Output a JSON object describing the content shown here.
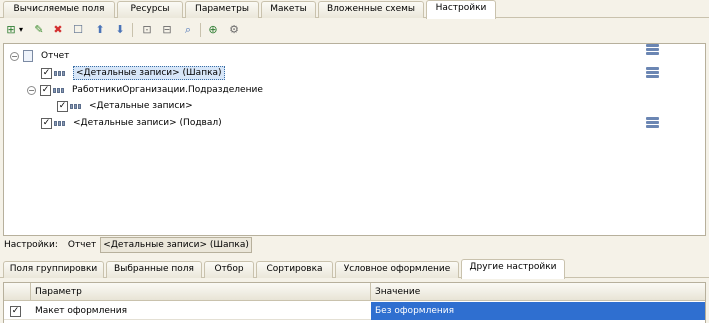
{
  "top_tabs": [
    {
      "label": "Вычисляемые поля",
      "active": false
    },
    {
      "label": "Ресурсы",
      "active": false
    },
    {
      "label": "Параметры",
      "active": false
    },
    {
      "label": "Макеты",
      "active": false
    },
    {
      "label": "Вложенные схемы",
      "active": false
    },
    {
      "label": "Настройки",
      "active": true
    }
  ],
  "toolbar": {
    "icons": [
      "add-grouping-icon",
      "dropdown-arrow-icon",
      "edit-icon",
      "delete-icon",
      "properties-icon",
      "move-up-icon",
      "move-down-icon",
      "group-icon",
      "ungroup-icon",
      "find-icon",
      "add-group-icon",
      "settings-icon"
    ],
    "glyphs": [
      "⊞",
      "▾",
      "✎",
      "✖",
      "☐",
      "⬆",
      "⬇",
      "⊡",
      "⊟",
      "⌕",
      "⊕",
      "⚙"
    ]
  },
  "tree": {
    "root": {
      "label": "Отчет",
      "expanded": true
    },
    "rows": [
      {
        "label": "<Детальные записи> (Шапка)",
        "checked": true,
        "selected": true,
        "level": 1
      },
      {
        "label": "РаботникиОрганизации.Подразделение",
        "checked": true,
        "selected": false,
        "level": 1
      },
      {
        "label": "<Детальные записи>",
        "checked": true,
        "selected": false,
        "level": 2
      },
      {
        "label": "<Детальные записи> (Подвал)",
        "checked": true,
        "selected": false,
        "level": 1
      }
    ]
  },
  "settings_line": {
    "label": "Настройки:",
    "path": "Отчет",
    "selected": "<Детальные записи> (Шапка)"
  },
  "bottom_tabs": [
    {
      "label": "Поля группировки",
      "active": false
    },
    {
      "label": "Выбранные поля",
      "active": false
    },
    {
      "label": "Отбор",
      "active": false
    },
    {
      "label": "Сортировка",
      "active": false
    },
    {
      "label": "Условное оформление",
      "active": false
    },
    {
      "label": "Другие настройки",
      "active": true
    }
  ],
  "table": {
    "columns": [
      "Параметр",
      "Значение"
    ],
    "rows": [
      {
        "checked": true,
        "param": "Макет оформления",
        "value": "Без оформления"
      }
    ]
  },
  "colors": {
    "selection": "#2f6fd0",
    "background": "#f5f2e8"
  }
}
